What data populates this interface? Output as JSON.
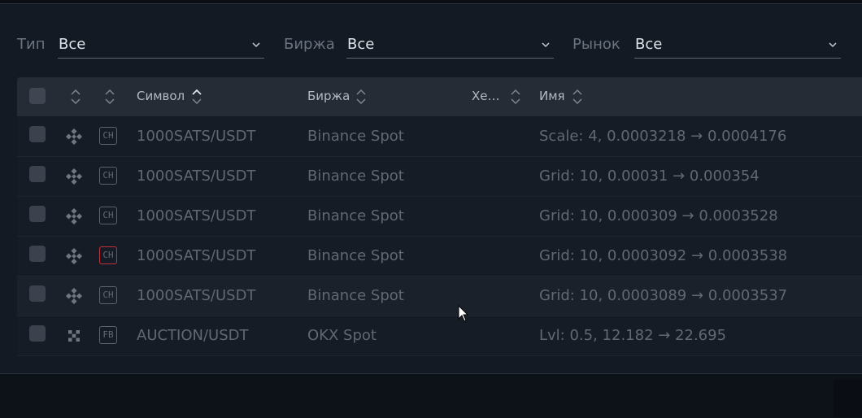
{
  "filters": [
    {
      "label": "Тип",
      "value": "Все"
    },
    {
      "label": "Биржа",
      "value": "Все"
    },
    {
      "label": "Рынок",
      "value": "Все"
    }
  ],
  "table": {
    "headers": {
      "symbol": "Символ",
      "exchange": "Биржа",
      "hedge": "Хе…",
      "name": "Имя"
    },
    "rows": [
      {
        "badge": "CH",
        "symbol": "1000SATS/USDT",
        "exchange": "Binance Spot",
        "name": "Scale: 4, 0.0003218 → 0.0004176",
        "exchange_icon": "binance-icon"
      },
      {
        "badge": "CH",
        "symbol": "1000SATS/USDT",
        "exchange": "Binance Spot",
        "name": "Grid: 10, 0.00031 → 0.000354",
        "exchange_icon": "binance-icon"
      },
      {
        "badge": "CH",
        "symbol": "1000SATS/USDT",
        "exchange": "Binance Spot",
        "name": "Grid: 10, 0.000309 → 0.0003528",
        "exchange_icon": "binance-icon"
      },
      {
        "badge": "CH",
        "symbol": "1000SATS/USDT",
        "exchange": "Binance Spot",
        "name": "Grid: 10, 0.0003092 → 0.0003538",
        "exchange_icon": "binance-icon",
        "badge_alert": true
      },
      {
        "badge": "CH",
        "symbol": "1000SATS/USDT",
        "exchange": "Binance Spot",
        "name": "Grid: 10, 0.0003089 → 0.0003537",
        "exchange_icon": "binance-icon"
      },
      {
        "badge": "FB",
        "symbol": "AUCTION/USDT",
        "exchange": "OKX Spot",
        "name": "Lvl: 0.5, 12.182 → 22.695",
        "exchange_icon": "okx-icon"
      }
    ]
  },
  "colors": {
    "accent_alert": "#c0323c",
    "text_primary": "#dfe4ea",
    "text_muted": "#5f6873"
  }
}
